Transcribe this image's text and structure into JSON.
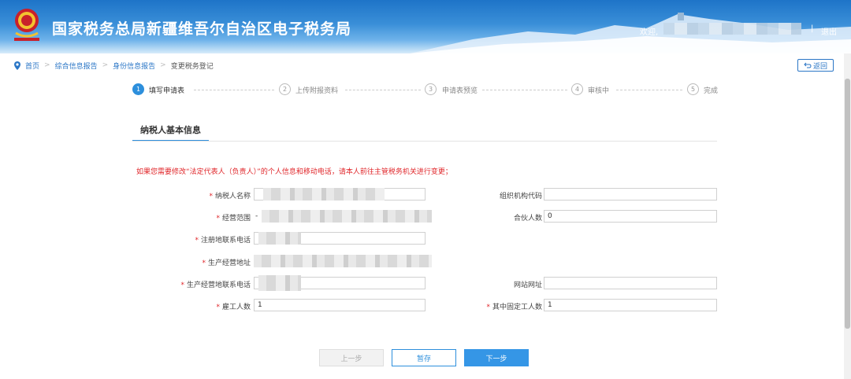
{
  "header": {
    "title": "国家税务总局新疆维吾尔自治区电子税务局",
    "welcome": "欢迎,",
    "separator": "|",
    "logout": "退出",
    "emblem_icon": "tax-emblem-icon"
  },
  "breadcrumb": {
    "items": [
      "首页",
      "综合信息报告",
      "身份信息报告",
      "变更税务登记"
    ],
    "separator": ">"
  },
  "back_button": {
    "label": "返回"
  },
  "steps": [
    {
      "num": "1",
      "label": "填写申请表",
      "active": true
    },
    {
      "num": "2",
      "label": "上传附报资料",
      "active": false
    },
    {
      "num": "3",
      "label": "申请表预览",
      "active": false
    },
    {
      "num": "4",
      "label": "审核中",
      "active": false
    },
    {
      "num": "5",
      "label": "完成",
      "active": false
    }
  ],
  "section": {
    "title": "纳税人基本信息"
  },
  "notice": "如果您需要修改“法定代表人（负责人）”的个人信息和移动电话，请本人前往主管税务机关进行变更；",
  "form": {
    "taxpayer_name_label": "纳税人名称",
    "org_code_label": "组织机构代码",
    "org_code_value": "",
    "business_scope_label": "经营范围",
    "business_scope_prefix": "-",
    "partners_label": "合伙人数",
    "partners_value": "0",
    "reg_phone_label": "注册地联系电话",
    "address_label": "生产经营地址",
    "biz_phone_label": "生产经营地联系电话",
    "website_label": "网站网址",
    "website_value": "",
    "employees_label": "雇工人数",
    "employees_value": "1",
    "fixed_employees_label": "其中固定工人数",
    "fixed_employees_value": "1"
  },
  "buttons": {
    "prev": "上一步",
    "save": "暂存",
    "next": "下一步"
  },
  "colors": {
    "accent": "#2d8fdc",
    "required": "#e0262a"
  }
}
